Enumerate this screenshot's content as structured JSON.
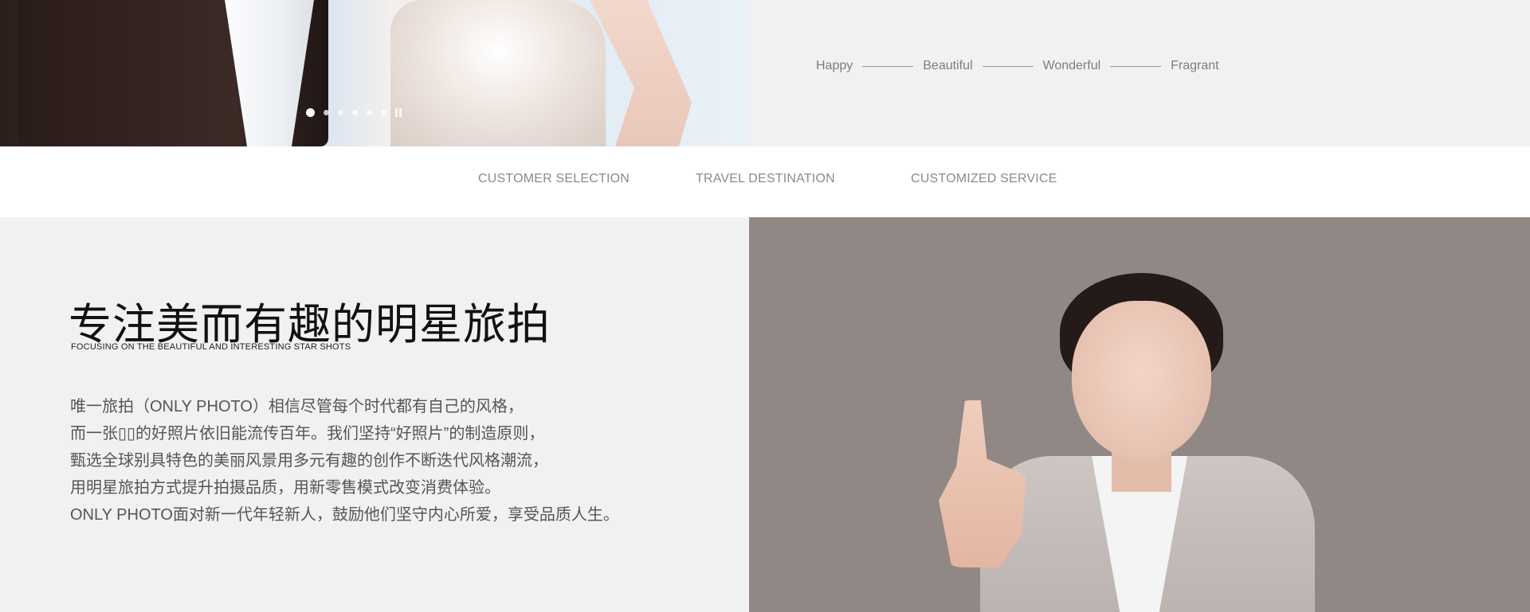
{
  "hero": {
    "slide_count": 6,
    "active_slide": 1,
    "words": [
      "Happy",
      "Beautiful",
      "Wonderful",
      "Fragrant"
    ]
  },
  "nav": {
    "items": [
      "CUSTOMER SELECTION",
      "TRAVEL DESTINATION",
      "CUSTOMIZED SERVICE"
    ]
  },
  "intro": {
    "title": "专注美而有趣的明星旅拍",
    "subtitle": "FOCUSING ON THE BEAUTIFUL AND INTERESTING STAR SHOTS",
    "lines": [
      "唯一旅拍（ONLY PHOTO）相信尽管每个时代都有自己的风格，",
      "而一张▯▯的好照片依旧能流传百年。我们坚持“好照片”的制造原则，",
      "甄选全球别具特色的美丽风景用多元有趣的创作不断迭代风格潮流，",
      "用明星旅拍方式提升拍摄品质，用新零售模式改变消费体验。",
      "ONLY PHOTO面对新一代年轻新人，鼓励他们坚守内心所爱，享受品质人生。"
    ]
  },
  "colors": {
    "page_bg": "#f1f1f1",
    "nav_bg": "#ffffff",
    "portrait_bg": "#918886",
    "nav_text": "#8a8a8a"
  }
}
